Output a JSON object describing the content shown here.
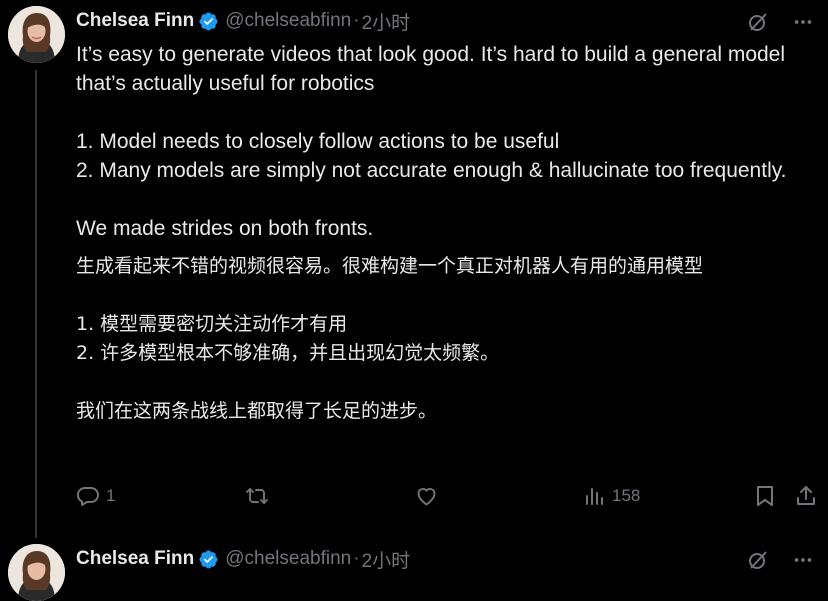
{
  "tweets": [
    {
      "author_name": "Chelsea Finn",
      "handle": "@chelseabfinn",
      "separator": "·",
      "time": "2小时",
      "text_en": "It’s easy to generate videos that look good. It’s hard to build a general model that’s actually useful for robotics\n\n1. Model needs to closely follow actions to be useful\n2. Many models are simply not accurate enough & hallucinate too frequently.\n\nWe made strides on both fronts.",
      "text_cn": "生成看起来不错的视频很容易。很难构建一个真正对机器人有用的通用模型\n\n1. 模型需要密切关注动作才有用\n2. 许多模型根本不够准确，并且出现幻觉太频繁。\n\n我们在这两条战线上都取得了长足的进步。",
      "replies": "1",
      "views": "158"
    },
    {
      "author_name": "Chelsea Finn",
      "handle": "@chelseabfinn",
      "separator": "·",
      "time": "2小时"
    }
  ],
  "colors": {
    "background": "#000000",
    "text": "#e7e9ea",
    "secondary_text": "#71767b",
    "verified": "#1d9bf0",
    "thread_line": "#333639"
  },
  "icons": {
    "top": [
      "grok-slash-icon",
      "more-icon"
    ],
    "actions": [
      "reply-icon",
      "retweet-icon",
      "like-icon",
      "views-icon",
      "bookmark-icon",
      "share-icon"
    ]
  }
}
